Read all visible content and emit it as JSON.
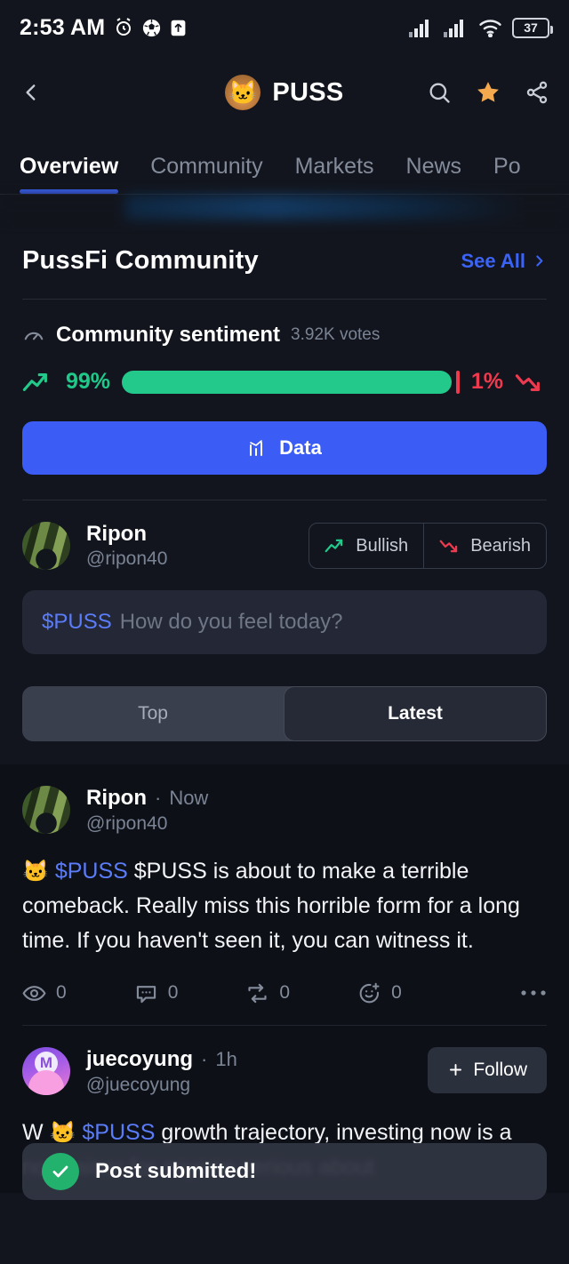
{
  "status_bar": {
    "time": "2:53 AM",
    "icons": [
      "alarm-icon",
      "soccer-ball-icon",
      "upload-arrow-icon"
    ],
    "right_icons": [
      "signal-1-icon",
      "signal-2-icon",
      "wifi-icon"
    ],
    "battery_level": "37"
  },
  "header": {
    "back_icon": "chevron-left-icon",
    "coin_emoji": "🐱",
    "title": "PUSS",
    "actions": [
      "search-icon",
      "star-icon",
      "share-icon"
    ],
    "star_color": "#f4a94f"
  },
  "tabs": {
    "items": [
      {
        "label": "Overview",
        "active": true
      },
      {
        "label": "Community",
        "active": false
      },
      {
        "label": "Markets",
        "active": false
      },
      {
        "label": "News",
        "active": false
      },
      {
        "label": "Po",
        "active": false
      }
    ],
    "active_indicator_color": "#3b63f6"
  },
  "community": {
    "section_title": "PussFi Community",
    "see_all_label": "See All",
    "see_all_chevron": "chevron-right-icon",
    "sentiment": {
      "icon": "gauge-icon",
      "label": "Community sentiment",
      "votes": "3.92K votes",
      "bullish_pct": "99%",
      "bearish_pct": "1%",
      "bullish_value": 99,
      "bearish_value": 1,
      "bullish_color": "#22c98a",
      "bearish_color": "#ee3a4f"
    },
    "data_button": {
      "label": "Data",
      "icon": "bar-chart-icon",
      "color": "#3b5cf5"
    }
  },
  "composer": {
    "user": {
      "name": "Ripon",
      "handle": "@ripon40"
    },
    "bullish_label": "Bullish",
    "bearish_label": "Bearish",
    "input_ticker": "$PUSS",
    "input_placeholder": "How do you feel today?"
  },
  "feed_filter": {
    "options": [
      {
        "label": "Top",
        "active": false
      },
      {
        "label": "Latest",
        "active": true
      }
    ]
  },
  "posts": [
    {
      "name": "Ripon",
      "time": "Now",
      "handle": "@ripon40",
      "emoji": "🐱",
      "cashtag": "$PUSS",
      "body": "$PUSS is about to make a terrible comeback.  Really miss this horrible form for a long time.  If you haven't seen it, you can witness it.",
      "actions": [
        {
          "icon": "eye-icon",
          "count": "0"
        },
        {
          "icon": "comment-icon",
          "count": "0"
        },
        {
          "icon": "repost-icon",
          "count": "0"
        },
        {
          "icon": "reaction-add-icon",
          "count": "0"
        }
      ],
      "more_icon": "more-horizontal-icon",
      "has_follow": false
    },
    {
      "name": "juecoyung",
      "time": "1h",
      "handle": "@juecoyung",
      "emoji": "🐱",
      "cashtag": "$PUSS",
      "body_prefix": "W",
      "body": "growth trajectory, investing now is a no-brainer for anyone serious about",
      "follow_label": "Follow",
      "follow_icon": "plus-icon",
      "has_follow": true
    }
  ],
  "toast": {
    "icon": "check-circle-icon",
    "message": "Post submitted!",
    "accent_color": "#23b26d"
  }
}
